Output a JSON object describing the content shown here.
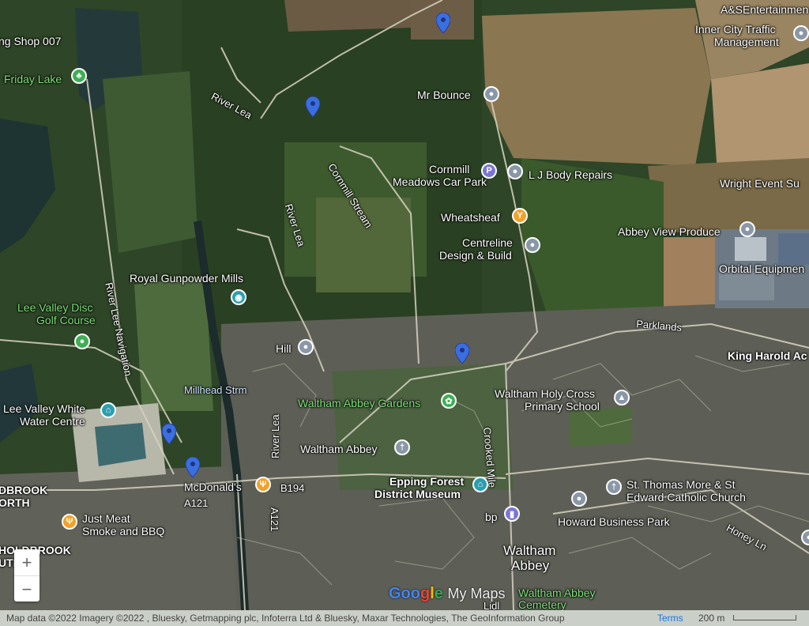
{
  "places": {
    "shop": "ng Shop 007",
    "friday_lake": "Friday Lake",
    "river_lea_1": "River Lea",
    "river_lea_2": "River Lea",
    "river_lea_3": "River Lea",
    "river_lee_nav": "River Lee Navigation",
    "cornmill_stream": "Cornmill Stream",
    "mr_bounce": "Mr Bounce",
    "cornmill_car_park_1": "Cornmill",
    "cornmill_car_park_2": "Meadows Car Park",
    "lj_body_repairs": "L J Body Repairs",
    "wheatsheaf": "Wheatsheaf",
    "centreline_1": "Centreline",
    "centreline_2": "Design & Build",
    "abbey_view": "Abbey View Produce",
    "orbital": "Orbital Equipmen",
    "wright_event": "Wright Event Su",
    "asentertainment": "A&SEntertainmen",
    "inner_city_1": "Inner City Traffic",
    "inner_city_2": "Management",
    "royal_gunpowder": "Royal Gunpowder Mills",
    "lee_valley_disc_1": "Lee Valley Disc",
    "lee_valley_disc_2": "Golf Course",
    "hill": "Hill",
    "parklands": "Parklands",
    "king_harold": "King Harold Ac",
    "millhead": "Millhead Strm",
    "lee_valley_white_1": "Lee Valley White",
    "lee_valley_white_2": "Water Centre",
    "waltham_abbey_gardens": "Waltham Abbey Gardens",
    "waltham_holy_cross_1": "Waltham Holy Cross",
    "waltham_holy_cross_2": "Primary School",
    "waltham_abbey_church": "Waltham Abbey",
    "river_lea_4": "River Lea",
    "crooked_mile": "Crooked Mile",
    "mcdonalds": "McDonald's",
    "b194": "B194",
    "a121_1": "A121",
    "a121_2": "A121",
    "epping_1": "Epping Forest",
    "epping_2": "District Museum",
    "st_thomas_1": "St. Thomas More & St",
    "st_thomas_2": "Edward Catholic Church",
    "bp": "bp",
    "howard": "Howard Business Park",
    "honey_ln": "Honey Ln",
    "just_meat_1": "Just Meat",
    "just_meat_2": "Smoke and BBQ",
    "holdbrook_n_1": "DBROOK",
    "holdbrook_n_2": "ORTH",
    "holdbrook_s_1": "HOLDBROOK",
    "holdbrook_s_2": "UTH",
    "waltham_town_1": "Waltham",
    "waltham_town_2": "Abbey",
    "cemetery_1": "Waltham Abbey",
    "cemetery_2": "Cemetery",
    "lidl": "Lidl"
  },
  "controls": {
    "zoom_in": "+",
    "zoom_out": "−"
  },
  "footer": {
    "attribution": "Map data ©2022 Imagery ©2022 , Bluesky, Getmapping plc, Infoterra Ltd & Bluesky, Maxar Technologies, The GeoInformation Group",
    "terms": "Terms",
    "scale": "200 m"
  },
  "logo": {
    "g1": "Goo",
    "g2": "g",
    "g3": "l",
    "g4": "e",
    "my_maps": "My Maps"
  },
  "colors": {
    "marker_blue": "#3b6fe0",
    "pin_gray": "#8a97a6",
    "pin_green": "#3fae55",
    "pin_teal": "#2a9fb0",
    "pin_orange": "#f1a22a",
    "pin_purple": "#7b76d6"
  },
  "icons": {
    "poi": "location-pin-icon",
    "parking": "parking-icon",
    "food": "fork-knife-icon",
    "bar": "cocktail-icon",
    "camera": "camera-icon",
    "church": "cross-icon",
    "school": "graduation-cap-icon",
    "museum": "museum-icon",
    "fuel": "fuel-pump-icon",
    "park": "tree-icon"
  }
}
